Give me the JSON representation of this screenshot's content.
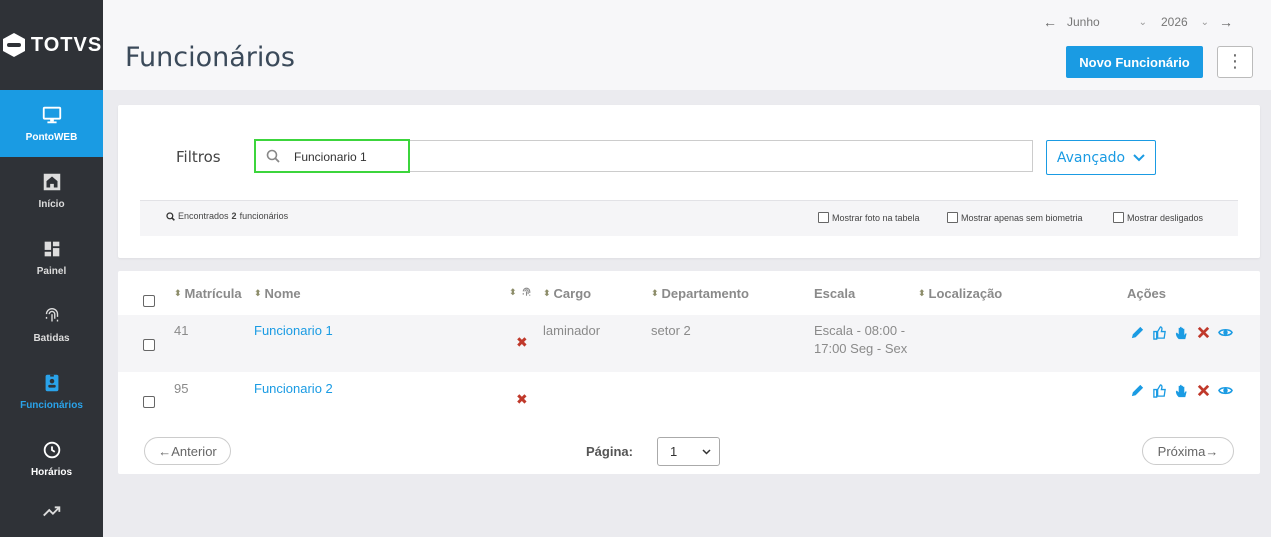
{
  "brand": {
    "logo_text": "TOTVS"
  },
  "sidebar": {
    "items": [
      {
        "label": "PontoWEB",
        "icon": "monitor-icon"
      },
      {
        "label": "Início",
        "icon": "home-icon"
      },
      {
        "label": "Painel",
        "icon": "dashboard-icon"
      },
      {
        "label": "Batidas",
        "icon": "fingerprint-icon"
      },
      {
        "label": "Funcionários",
        "icon": "badge-icon"
      },
      {
        "label": "Horários",
        "icon": "clock-icon"
      },
      {
        "label": "",
        "icon": "trend-icon"
      }
    ]
  },
  "header": {
    "title": "Funcionários",
    "month": "Junho",
    "year": "2026",
    "new_button": "Novo Funcionário",
    "more_icon": "kebab-icon"
  },
  "filters": {
    "label": "Filtros",
    "search_value": "Funcionario 1",
    "advanced_label": "Avançado",
    "found_prefix": "Encontrados",
    "found_count": "2",
    "found_suffix": "funcionários",
    "opt_photo": "Mostrar foto na tabela",
    "opt_biometry": "Mostrar apenas sem biometria",
    "opt_dismissed": "Mostrar desligados"
  },
  "table": {
    "headers": {
      "matricula": "Matrícula",
      "nome": "Nome",
      "cargo": "Cargo",
      "departamento": "Departamento",
      "escala": "Escala",
      "localizacao": "Localização",
      "acoes": "Ações"
    },
    "rows": [
      {
        "matricula": "41",
        "nome": "Funcionario 1",
        "cargo": "laminador",
        "departamento": "setor 2",
        "escala_l1": "Escala - 08:00 -",
        "escala_l2": "17:00 Seg - Sex",
        "localizacao": ""
      },
      {
        "matricula": "95",
        "nome": "Funcionario 2",
        "cargo": "",
        "departamento": "",
        "escala_l1": "",
        "escala_l2": "",
        "localizacao": ""
      }
    ]
  },
  "pagination": {
    "prev": "←Anterior",
    "page_label": "Página:",
    "page_value": "1",
    "next": "Próxima→"
  },
  "colors": {
    "accent": "#1a9be3",
    "sidebar": "#2f3237",
    "highlight": "#3cd53c",
    "danger": "#c0392b"
  }
}
